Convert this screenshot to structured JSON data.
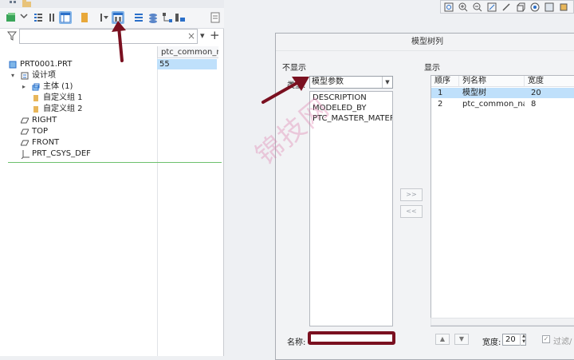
{
  "tree": {
    "column_header": "ptc_common_na",
    "filter_placeholder": "",
    "clear_glyph": "×",
    "dropdown_glyph": "▾",
    "add_glyph": "+",
    "root": {
      "label": "PRT0001.PRT",
      "value": "55"
    },
    "items": [
      {
        "label": "设计项",
        "icon": "design-item-icon"
      },
      {
        "label": "主体 (1)",
        "icon": "body-icon"
      },
      {
        "label": "自定义组 1",
        "icon": "group-icon"
      },
      {
        "label": "自定义组 2",
        "icon": "group-icon"
      },
      {
        "label": "RIGHT",
        "icon": "datum-plane-icon"
      },
      {
        "label": "TOP",
        "icon": "datum-plane-icon"
      },
      {
        "label": "FRONT",
        "icon": "datum-plane-icon"
      },
      {
        "label": "PRT_CSYS_DEF",
        "icon": "csys-icon"
      }
    ]
  },
  "dialog": {
    "title": "模型树列",
    "not_shown_label": "不显示",
    "shown_label": "显示",
    "type_label": "类型:",
    "type_value": "模型参数",
    "params": [
      "DESCRIPTION",
      "MODELED_BY",
      "PTC_MASTER_MATERIA"
    ],
    "add_button": ">>",
    "remove_button": "<<",
    "table_headers": [
      "顺序",
      "列名称",
      "宽度"
    ],
    "table_rows": [
      {
        "order": "1",
        "name": "模型树",
        "width": "20"
      },
      {
        "order": "2",
        "name": "ptc_common_nar",
        "width": "8"
      }
    ],
    "name_label": "名称:",
    "width_label": "宽度:",
    "width_value": "20",
    "filter_label": "过滤/",
    "up_glyph": "▲",
    "down_glyph": "▼"
  },
  "colors": {
    "highlight": "#bfe0fb",
    "annotation": "#7a1020",
    "selected_tool": "#cfe4f7"
  },
  "watermark": "锦技网"
}
